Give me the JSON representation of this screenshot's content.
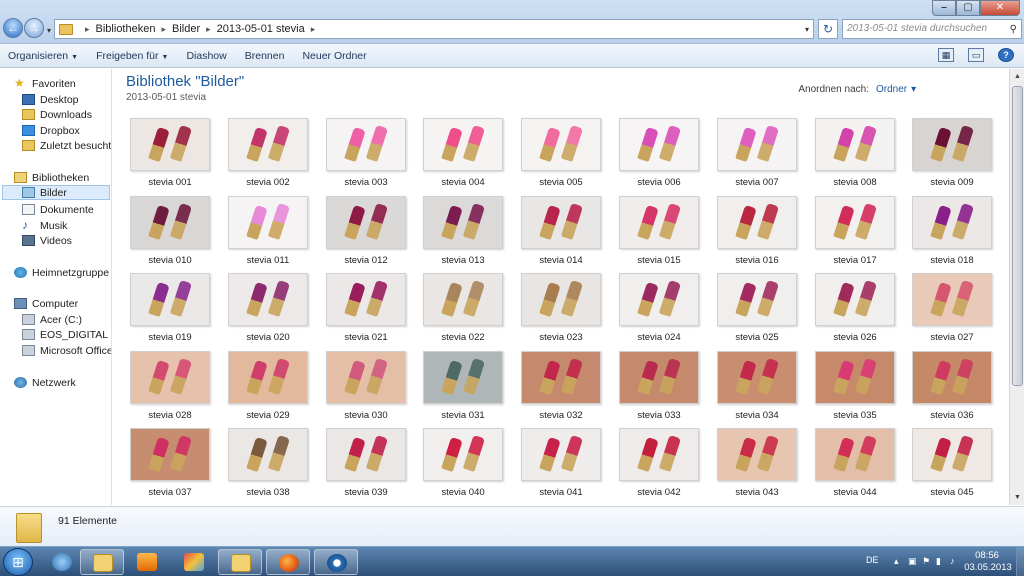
{
  "breadcrumb": [
    "Bibliotheken",
    "Bilder",
    "2013-05-01 stevia"
  ],
  "search": {
    "placeholder": "2013-05-01 stevia durchsuchen"
  },
  "toolbar": {
    "organize": "Organisieren",
    "share": "Freigeben für",
    "slideshow": "Diashow",
    "burn": "Brennen",
    "new_folder": "Neuer Ordner"
  },
  "nav": {
    "favorites": "Favoriten",
    "desktop": "Desktop",
    "downloads": "Downloads",
    "dropbox": "Dropbox",
    "recent": "Zuletzt besucht",
    "libraries": "Bibliotheken",
    "pictures": "Bilder",
    "documents": "Dokumente",
    "music": "Musik",
    "videos": "Videos",
    "homegroup": "Heimnetzgruppe",
    "computer": "Computer",
    "drive_c": "Acer (C:)",
    "drive_g": "EOS_DIGITAL (G:)",
    "office": "Microsoft Office K",
    "network": "Netzwerk"
  },
  "library": {
    "title": "Bibliothek \"Bilder\"",
    "subtitle": "2013-05-01 stevia",
    "sort_label": "Anordnen nach:",
    "sort_value": "Ordner"
  },
  "files": [
    {
      "label": "stevia 001",
      "bg": "#ede7e4",
      "subject": "#9b1e3b"
    },
    {
      "label": "stevia 002",
      "bg": "#f2eeec",
      "subject": "#c2346a"
    },
    {
      "label": "stevia 003",
      "bg": "#f5f3f3",
      "subject": "#ef5fa6"
    },
    {
      "label": "stevia 004",
      "bg": "#f6f3f3",
      "subject": "#ee4e8a"
    },
    {
      "label": "stevia 005",
      "bg": "#f5f2f2",
      "subject": "#f26b9f"
    },
    {
      "label": "stevia 006",
      "bg": "#f6f4f4",
      "subject": "#d94fb8"
    },
    {
      "label": "stevia 007",
      "bg": "#f5f3f3",
      "subject": "#de5fc0"
    },
    {
      "label": "stevia 008",
      "bg": "#f4f1f1",
      "subject": "#d443aa"
    },
    {
      "label": "stevia 009",
      "bg": "#d8d4d2",
      "subject": "#6a1236"
    },
    {
      "label": "stevia 010",
      "bg": "#d9d6d6",
      "subject": "#6e1b3e"
    },
    {
      "label": "stevia 011",
      "bg": "#f6f3f4",
      "subject": "#e78bd8"
    },
    {
      "label": "stevia 012",
      "bg": "#dbd8d8",
      "subject": "#8c1a45"
    },
    {
      "label": "stevia 013",
      "bg": "#dcd9d9",
      "subject": "#7c1d52"
    },
    {
      "label": "stevia 014",
      "bg": "#e9e6e6",
      "subject": "#b8244d"
    },
    {
      "label": "stevia 015",
      "bg": "#f1eded",
      "subject": "#d6356a"
    },
    {
      "label": "stevia 016",
      "bg": "#f1eeee",
      "subject": "#b8263f"
    },
    {
      "label": "stevia 017",
      "bg": "#f3f0f0",
      "subject": "#d02d5a"
    },
    {
      "label": "stevia 018",
      "bg": "#ece8e8",
      "subject": "#8a1f8a"
    },
    {
      "label": "stevia 019",
      "bg": "#ebe8e8",
      "subject": "#8b2c8f"
    },
    {
      "label": "stevia 020",
      "bg": "#ede9e8",
      "subject": "#8d2a6e"
    },
    {
      "label": "stevia 021",
      "bg": "#ece8e8",
      "subject": "#9a1d5b"
    },
    {
      "label": "stevia 022",
      "bg": "#eae6e3",
      "subject": "#a9855c"
    },
    {
      "label": "stevia 023",
      "bg": "#e9e5e2",
      "subject": "#a77d50"
    },
    {
      "label": "stevia 024",
      "bg": "#f1eeee",
      "subject": "#9a2a5e"
    },
    {
      "label": "stevia 025",
      "bg": "#f1eeee",
      "subject": "#a22a5e"
    },
    {
      "label": "stevia 026",
      "bg": "#f1eeee",
      "subject": "#a02a5a"
    },
    {
      "label": "stevia 027",
      "bg": "#e9c9b8",
      "subject": "#d7566f"
    },
    {
      "label": "stevia 028",
      "bg": "#e6c2ad",
      "subject": "#d44b72"
    },
    {
      "label": "stevia 029",
      "bg": "#e2b99d",
      "subject": "#cf3d6a"
    },
    {
      "label": "stevia 030",
      "bg": "#e4bea6",
      "subject": "#cf5a7e"
    },
    {
      "label": "stevia 031",
      "bg": "#aeb6b7",
      "subject": "#4d6b62"
    },
    {
      "label": "stevia 032",
      "bg": "#c58a6d",
      "subject": "#c2264b"
    },
    {
      "label": "stevia 033",
      "bg": "#c48a6b",
      "subject": "#b82a4e"
    },
    {
      "label": "stevia 034",
      "bg": "#c98e6f",
      "subject": "#c3284d"
    },
    {
      "label": "stevia 035",
      "bg": "#c68a6a",
      "subject": "#d93a73"
    },
    {
      "label": "stevia 036",
      "bg": "#c58968",
      "subject": "#cf3a60"
    },
    {
      "label": "stevia 037",
      "bg": "#c68d70",
      "subject": "#d02f61"
    },
    {
      "label": "stevia 038",
      "bg": "#ebe7e5",
      "subject": "#7a5a3d"
    },
    {
      "label": "stevia 039",
      "bg": "#ebe7e7",
      "subject": "#c0204a"
    },
    {
      "label": "stevia 040",
      "bg": "#f1eeee",
      "subject": "#cf1f45"
    },
    {
      "label": "stevia 041",
      "bg": "#efecec",
      "subject": "#c9224a"
    },
    {
      "label": "stevia 042",
      "bg": "#efebeb",
      "subject": "#c3203e"
    },
    {
      "label": "stevia 043",
      "bg": "#e6c5b1",
      "subject": "#c92c47"
    },
    {
      "label": "stevia 044",
      "bg": "#e3bea8",
      "subject": "#d22e57"
    },
    {
      "label": "stevia 045",
      "bg": "#efe9e6",
      "subject": "#c21f45"
    }
  ],
  "details": {
    "count": "91 Elemente"
  },
  "tray": {
    "language": "DE",
    "time": "08:56",
    "date": "03.05.2013"
  },
  "colors": {
    "accent": "#1e5b9c",
    "selection": "#dcebfc",
    "taskbar": "#2c4f78"
  },
  "icons": [
    "back-icon",
    "forward-icon",
    "folder-icon",
    "refresh-icon",
    "search-icon",
    "help-icon",
    "start-orb-icon",
    "explorer-icon",
    "media-player-icon",
    "paint-icon",
    "firefox-icon",
    "camera-icon"
  ]
}
